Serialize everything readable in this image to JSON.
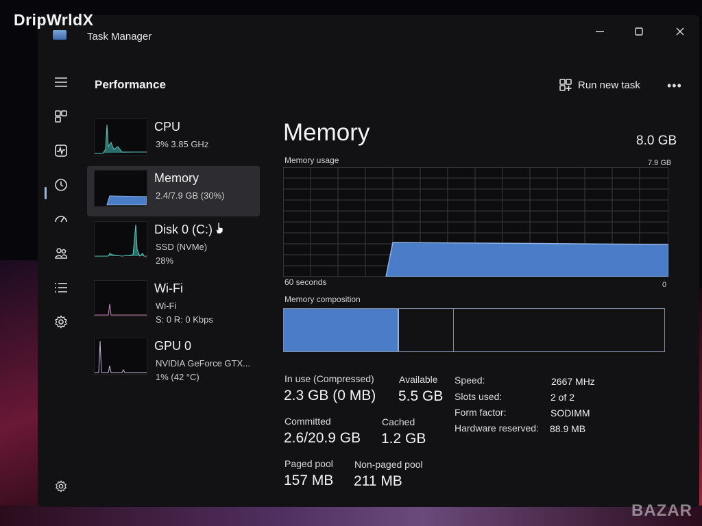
{
  "watermark_top": "DripWrldX",
  "watermark_bottom": "BAZAR",
  "window": {
    "title": "Task Manager",
    "controls": [
      "minimize",
      "maximize",
      "close"
    ]
  },
  "header": {
    "title": "Performance",
    "run_new_task": "Run new task",
    "more_icon": "more-icon"
  },
  "nav": [
    {
      "icon": "hamburger-icon"
    },
    {
      "icon": "processes-icon"
    },
    {
      "icon": "performance-icon",
      "selected": true
    },
    {
      "icon": "app-history-icon"
    },
    {
      "icon": "startup-apps-icon"
    },
    {
      "icon": "users-icon"
    },
    {
      "icon": "details-icon"
    },
    {
      "icon": "services-icon"
    },
    {
      "icon": "settings-icon"
    }
  ],
  "devices": [
    {
      "name": "CPU",
      "line1": "3% 3.85 GHz",
      "line2": ""
    },
    {
      "name": "Memory",
      "line1": "2.4/7.9 GB (30%)",
      "line2": "",
      "selected": true
    },
    {
      "name": "Disk 0 (C:)",
      "line1": "SSD (NVMe)",
      "line2": "28%"
    },
    {
      "name": "Wi-Fi",
      "line1": "Wi-Fi",
      "line2": "S: 0 R: 0 Kbps"
    },
    {
      "name": "GPU 0",
      "line1": "NVIDIA GeForce GTX...",
      "line2": "1% (42 °C)"
    }
  ],
  "memory": {
    "title": "Memory",
    "total": "8.0 GB",
    "usage_label": "Memory usage",
    "usage_max": "7.9 GB",
    "axis_left": "60 seconds",
    "axis_right": "0",
    "composition_label": "Memory composition",
    "in_use_label": "In use (Compressed)",
    "in_use_value": "2.3 GB (0 MB)",
    "available_label": "Available",
    "available_value": "5.5 GB",
    "committed_label": "Committed",
    "committed_value": "2.6/20.9 GB",
    "cached_label": "Cached",
    "cached_value": "1.2 GB",
    "paged_label": "Paged pool",
    "paged_value": "157 MB",
    "nonpaged_label": "Non-paged pool",
    "nonpaged_value": "211 MB",
    "speed_label": "Speed:",
    "speed_value": "2667 MHz",
    "slots_label": "Slots used:",
    "slots_value": "2 of 2",
    "form_label": "Form factor:",
    "form_value": "SODIMM",
    "hwres_label": "Hardware reserved:",
    "hwres_value": "88.9 MB"
  },
  "colors": {
    "accent": "#4b7cc8",
    "accent_light": "#8fb3e6",
    "bg": "#121215",
    "selected_row": "#2c2c31",
    "cpu_graph": "#5fc8c0",
    "gpu_graph": "#c8b8e0"
  }
}
